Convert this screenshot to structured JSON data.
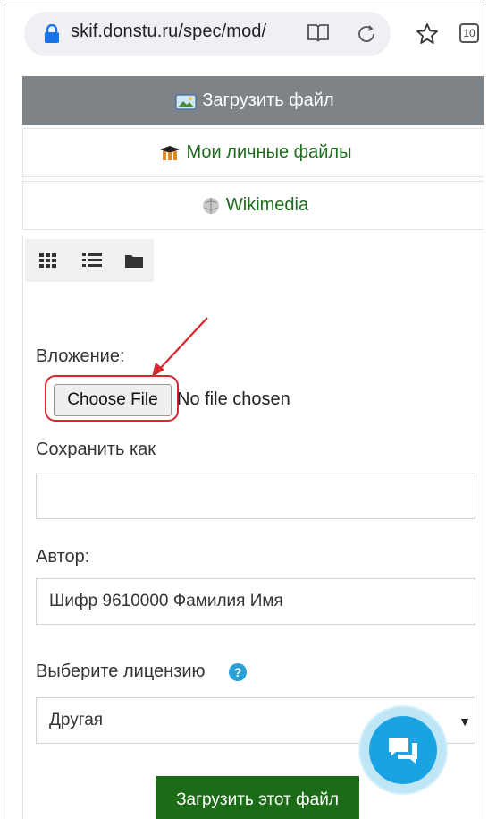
{
  "browser": {
    "url": "skif.donstu.ru/spec/mod/",
    "tab_count": "10"
  },
  "repositories": [
    {
      "label": "Загрузить файл",
      "active": true
    },
    {
      "label": "Мои личные файлы",
      "active": false
    },
    {
      "label": "Wikimedia",
      "active": false
    }
  ],
  "form": {
    "attachment_label": "Вложение:",
    "choose_file_label": "Choose File",
    "no_file_text": "No file chosen",
    "save_as_label": "Сохранить как",
    "save_as_value": "",
    "author_label": "Автор:",
    "author_value": "Шифр 9610000 Фамилия Имя",
    "license_label": "Выберите лицензию",
    "license_value": "Другая",
    "submit_label": "Загрузить этот файл"
  },
  "colors": {
    "active_tab_bg": "#7e8388",
    "link_green": "#1e6b1e",
    "submit_bg": "#1c6b17",
    "highlight_red": "#d7262c",
    "chat_blue": "#1aa3e3"
  },
  "icons": [
    "lock-icon",
    "book-icon",
    "reload-icon",
    "star-icon",
    "tabs-icon",
    "upload-icon",
    "private-files-icon",
    "wikimedia-icon",
    "grid-view-icon",
    "list-view-icon",
    "folder-view-icon",
    "help-icon",
    "chat-icon"
  ]
}
